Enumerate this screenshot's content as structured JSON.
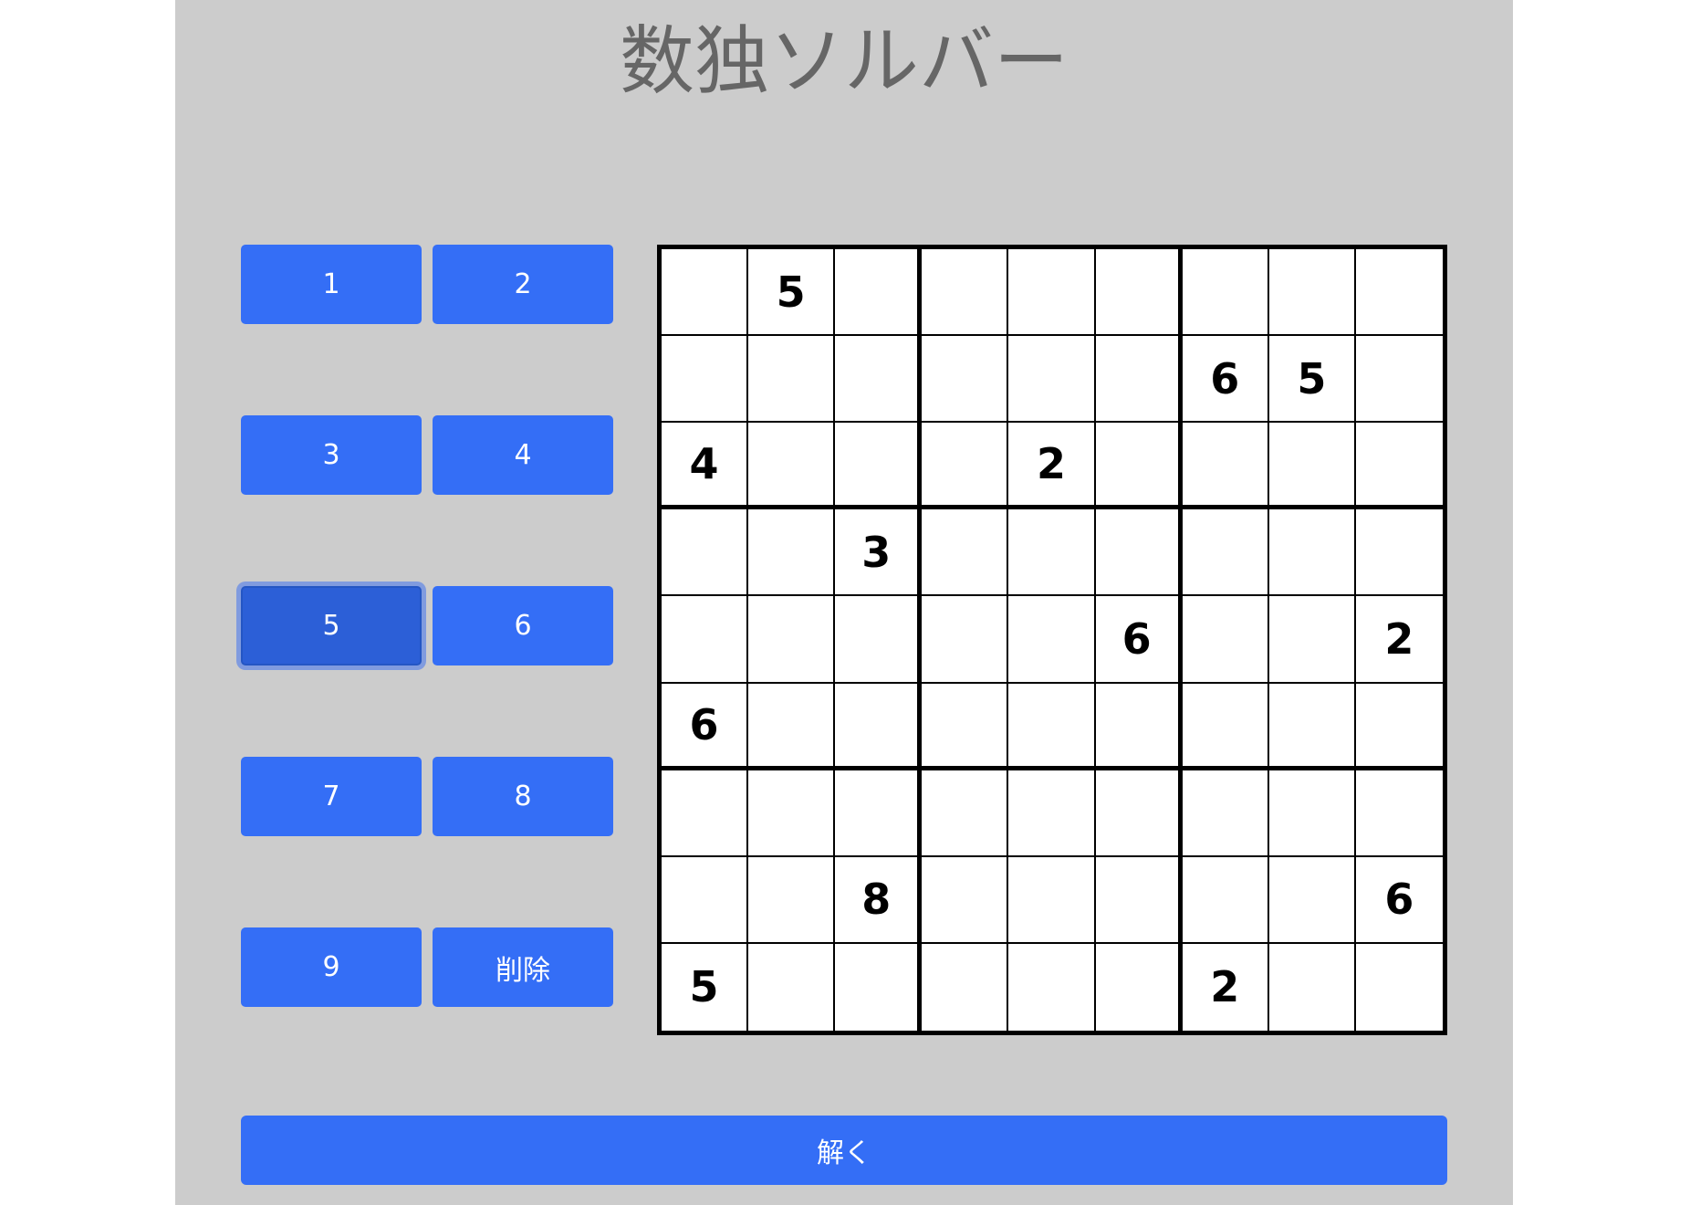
{
  "app": {
    "title": "数独ソルバー"
  },
  "keypad": {
    "buttons": [
      {
        "label": "1",
        "selected": false
      },
      {
        "label": "2",
        "selected": false
      },
      {
        "label": "3",
        "selected": false
      },
      {
        "label": "4",
        "selected": false
      },
      {
        "label": "5",
        "selected": true
      },
      {
        "label": "6",
        "selected": false
      },
      {
        "label": "7",
        "selected": false
      },
      {
        "label": "8",
        "selected": false
      },
      {
        "label": "9",
        "selected": false
      },
      {
        "label": "削除",
        "selected": false
      }
    ]
  },
  "board": {
    "rows": [
      [
        "",
        "5",
        "",
        "",
        "",
        "",
        "",
        "",
        ""
      ],
      [
        "",
        "",
        "",
        "",
        "",
        "",
        "6",
        "5",
        ""
      ],
      [
        "4",
        "",
        "",
        "",
        "2",
        "",
        "",
        "",
        ""
      ],
      [
        "",
        "",
        "3",
        "",
        "",
        "",
        "",
        "",
        ""
      ],
      [
        "",
        "",
        "",
        "",
        "",
        "6",
        "",
        "",
        "2"
      ],
      [
        "6",
        "",
        "",
        "",
        "",
        "",
        "",
        "",
        ""
      ],
      [
        "",
        "",
        "",
        "",
        "",
        "",
        "",
        "",
        ""
      ],
      [
        "",
        "",
        "8",
        "",
        "",
        "",
        "",
        "",
        "6"
      ],
      [
        "5",
        "",
        "",
        "",
        "",
        "",
        "2",
        "",
        ""
      ]
    ]
  },
  "actions": {
    "solve_label": "解く"
  },
  "colors": {
    "page_background": "#cccccc",
    "button_blue": "#346ef6",
    "button_selected": "#2c5fd7",
    "title_text": "#666666"
  }
}
